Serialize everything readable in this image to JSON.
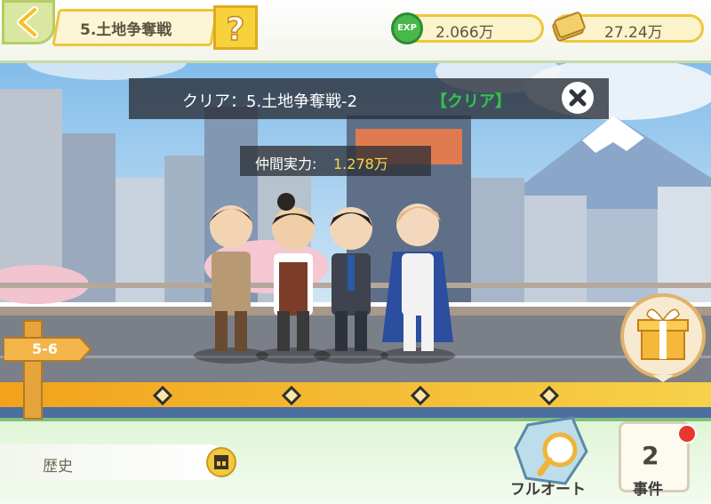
{
  "header": {
    "back_icon": "chevron-left-icon",
    "stage_title": "5.土地争奪戦",
    "help_icon": "question-mark-icon",
    "exp_icon_label": "EXP",
    "exp_value": "2.066万",
    "money_icon": "money-stack-icon",
    "money_value": "27.24万"
  },
  "banner": {
    "clear_prefix": "クリア：5.土地争奪戦-2",
    "clear_tag": "【クリア】",
    "close_icon": "close-icon"
  },
  "team_power": {
    "label": "仲間実力:",
    "value": "1.278万"
  },
  "progress": {
    "stage_sign": "5-6",
    "checkpoints": 4
  },
  "gift_icon": "gift-box-icon",
  "history": {
    "label": "歴史",
    "icon": "film-clapper-icon"
  },
  "auto_button": {
    "label": "フルオート",
    "icon": "magnifier-gear-icon"
  },
  "events_button": {
    "count": "2",
    "label": "事件",
    "badge": "notification-dot"
  },
  "colors": {
    "accent_yellow": "#f7d23c",
    "road_orange": "#f39a1d",
    "clear_green": "#34c24a",
    "power_yellow": "#f5d84a",
    "notice_red": "#e8372c"
  }
}
